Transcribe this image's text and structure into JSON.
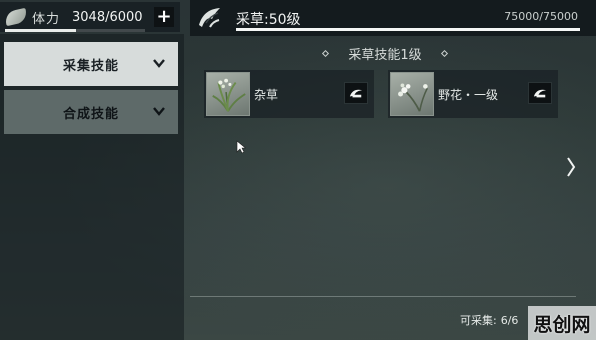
{
  "stamina": {
    "label": "体力",
    "value": "3048/6000",
    "plus_label": "+",
    "fill_fraction": 0.508
  },
  "skills": {
    "items": [
      {
        "label": "采集技能",
        "active": true
      },
      {
        "label": "合成技能",
        "active": false
      }
    ]
  },
  "header": {
    "title": "采草:50级",
    "xp": "75000/75000",
    "xp_fraction": 1.0
  },
  "section": {
    "title": "采草技能1级"
  },
  "herbs": [
    {
      "name": "杂草",
      "icon": "weed-icon",
      "tool_icon": "sickle-icon"
    },
    {
      "name": "野花・一级",
      "icon": "wildflower-icon",
      "tool_icon": "sickle-icon"
    }
  ],
  "footer": {
    "gatherable_label": "可采集:",
    "gatherable_count": "6/6"
  },
  "watermark": "思创网",
  "icons": {
    "stamina": "leaf-icon",
    "header": "herb-emblem-icon",
    "next": "chevron-right-icon",
    "cursor": "mouse-cursor-icon"
  },
  "colors": {
    "active_tab": "#d7dcdb",
    "inactive_tab": "#5e6a69",
    "panel": "#141c20",
    "bar_fill": "#f5f7f6"
  }
}
